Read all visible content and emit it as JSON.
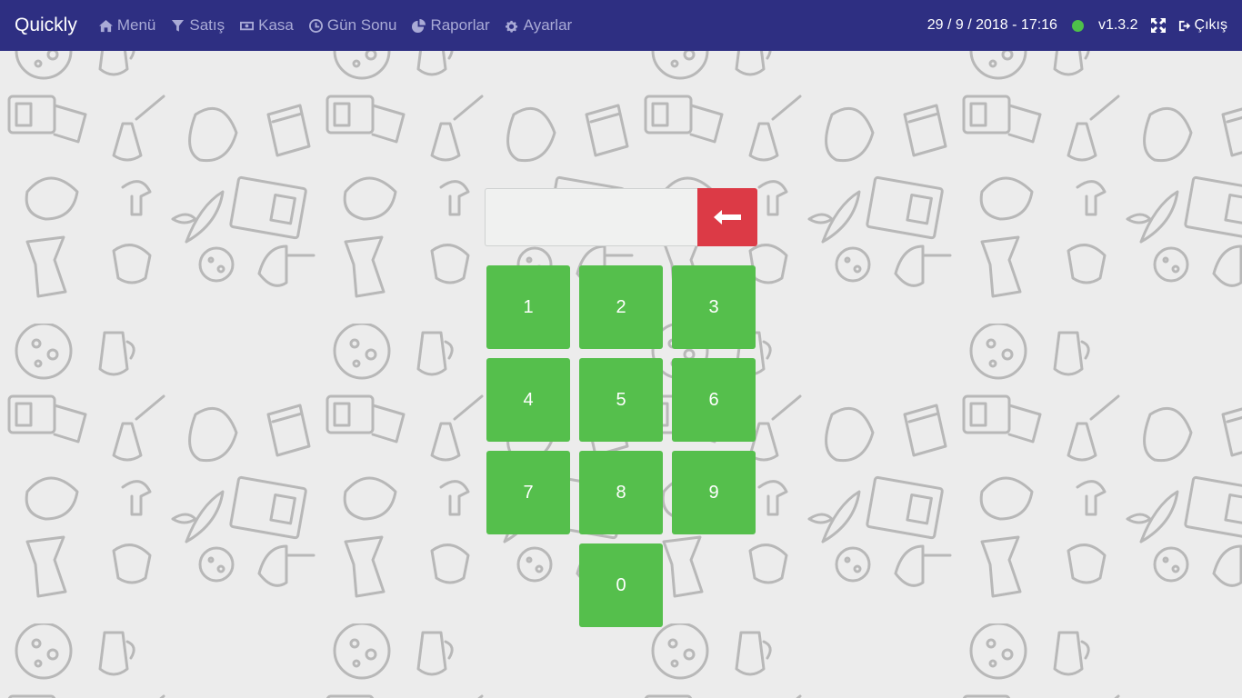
{
  "app": {
    "brand": "Quickly"
  },
  "nav": {
    "items": [
      {
        "label": "Menü",
        "icon": "home-icon"
      },
      {
        "label": "Satış",
        "icon": "filter-icon"
      },
      {
        "label": "Kasa",
        "icon": "money-icon"
      },
      {
        "label": "Gün Sonu",
        "icon": "clock-icon"
      },
      {
        "label": "Raporlar",
        "icon": "pie-chart-icon"
      },
      {
        "label": "Ayarlar",
        "icon": "cogs-icon"
      }
    ],
    "datetime": "29 / 9 / 2018 - 17:16",
    "status_color": "#4ec04a",
    "version": "v1.3.2",
    "logout_label": "Çıkış"
  },
  "pin": {
    "value": "",
    "keys": [
      "1",
      "2",
      "3",
      "4",
      "5",
      "6",
      "7",
      "8",
      "9",
      "0"
    ]
  },
  "colors": {
    "navbar": "#2e2f82",
    "key": "#55bf4c",
    "backspace": "#dc3a46",
    "background": "#ececec"
  }
}
